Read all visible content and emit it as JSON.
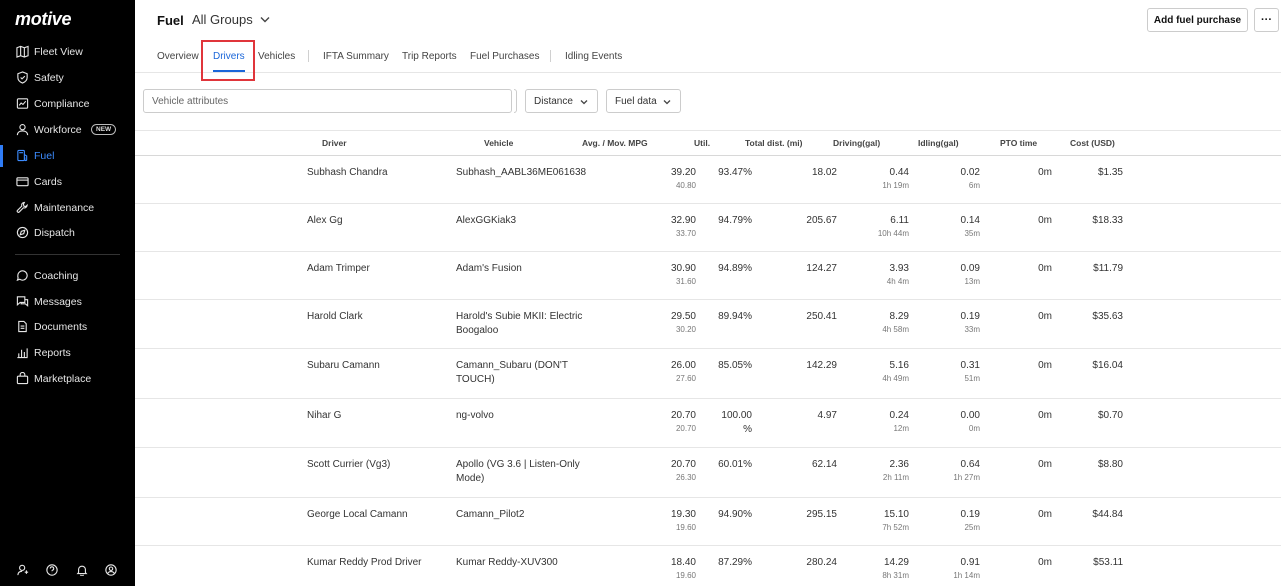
{
  "app": {
    "logo": "motive"
  },
  "sidebar": {
    "items": [
      {
        "label": "Fleet View",
        "icon": "map-icon"
      },
      {
        "label": "Safety",
        "icon": "shield-icon"
      },
      {
        "label": "Compliance",
        "icon": "compliance-icon"
      },
      {
        "label": "Workforce",
        "icon": "person-icon",
        "badge": "NEW"
      },
      {
        "label": "Fuel",
        "icon": "fuel-icon",
        "active": true
      },
      {
        "label": "Cards",
        "icon": "card-icon"
      },
      {
        "label": "Maintenance",
        "icon": "wrench-icon"
      },
      {
        "label": "Dispatch",
        "icon": "dispatch-icon"
      },
      {
        "label": "Coaching",
        "icon": "coaching-icon"
      },
      {
        "label": "Messages",
        "icon": "messages-icon"
      },
      {
        "label": "Documents",
        "icon": "document-icon"
      },
      {
        "label": "Reports",
        "icon": "reports-icon"
      },
      {
        "label": "Marketplace",
        "icon": "bag-icon"
      }
    ],
    "bottom_icons": [
      "user-icon",
      "help-icon",
      "bell-icon",
      "account-icon"
    ]
  },
  "header": {
    "title": "Fuel",
    "group": "All Groups",
    "add_button": "Add fuel purchase",
    "more_button": "···"
  },
  "tabs": [
    {
      "label": "Overview"
    },
    {
      "label": "Drivers",
      "active": true
    },
    {
      "label": "Vehicles"
    },
    {
      "label": "IFTA Summary"
    },
    {
      "label": "Trip Reports"
    },
    {
      "label": "Fuel Purchases"
    },
    {
      "label": "Idling Events"
    }
  ],
  "filters": {
    "search_placeholder": "Vehicle attributes",
    "distance": "Distance",
    "fuel_data": "Fuel data"
  },
  "table": {
    "columns": [
      "Driver",
      "Vehicle",
      "Avg. / Mov. MPG",
      "Util.",
      "Total dist. (mi)",
      "Driving(gal)",
      "Idling(gal)",
      "PTO time",
      "Cost (USD)"
    ],
    "rows": [
      {
        "driver": "Subhash Chandra",
        "vehicle": "Subhash_AABL36ME061638",
        "avg": "39.20",
        "mov": "40.80",
        "util": "93.47%",
        "dist": "18.02",
        "driving": "0.44",
        "driving_time": "1h 19m",
        "idling": "0.02",
        "idling_time": "6m",
        "pto": "0m",
        "cost": "$1.35"
      },
      {
        "driver": "Alex Gg",
        "vehicle": "AlexGGKiak3",
        "avg": "32.90",
        "mov": "33.70",
        "util": "94.79%",
        "dist": "205.67",
        "driving": "6.11",
        "driving_time": "10h 44m",
        "idling": "0.14",
        "idling_time": "35m",
        "pto": "0m",
        "cost": "$18.33"
      },
      {
        "driver": "Adam Trimper",
        "vehicle": "Adam's Fusion",
        "avg": "30.90",
        "mov": "31.60",
        "util": "94.89%",
        "dist": "124.27",
        "driving": "3.93",
        "driving_time": "4h 4m",
        "idling": "0.09",
        "idling_time": "13m",
        "pto": "0m",
        "cost": "$11.79"
      },
      {
        "driver": "Harold Clark",
        "vehicle": "Harold's Subie MKII: Electric Boogaloo",
        "avg": "29.50",
        "mov": "30.20",
        "util": "89.94%",
        "dist": "250.41",
        "driving": "8.29",
        "driving_time": "4h 58m",
        "idling": "0.19",
        "idling_time": "33m",
        "pto": "0m",
        "cost": "$35.63"
      },
      {
        "driver": "Subaru Camann",
        "vehicle": "Camann_Subaru (DON'T TOUCH)",
        "avg": "26.00",
        "mov": "27.60",
        "util": "85.05%",
        "dist": "142.29",
        "driving": "5.16",
        "driving_time": "4h 49m",
        "idling": "0.31",
        "idling_time": "51m",
        "pto": "0m",
        "cost": "$16.04"
      },
      {
        "driver": "Nihar G",
        "vehicle": "ng-volvo",
        "avg": "20.70",
        "mov": "20.70",
        "util": "100.00 %",
        "dist": "4.97",
        "driving": "0.24",
        "driving_time": "12m",
        "idling": "0.00",
        "idling_time": "0m",
        "pto": "0m",
        "cost": "$0.70"
      },
      {
        "driver": "Scott Currier (Vg3)",
        "vehicle": "Apollo (VG 3.6 | Listen-Only Mode)",
        "avg": "20.70",
        "mov": "26.30",
        "util": "60.01%",
        "dist": "62.14",
        "driving": "2.36",
        "driving_time": "2h 11m",
        "idling": "0.64",
        "idling_time": "1h 27m",
        "pto": "0m",
        "cost": "$8.80"
      },
      {
        "driver": "George Local Camann",
        "vehicle": "Camann_Pilot2",
        "avg": "19.30",
        "mov": "19.60",
        "util": "94.90%",
        "dist": "295.15",
        "driving": "15.10",
        "driving_time": "7h 52m",
        "idling": "0.19",
        "idling_time": "25m",
        "pto": "0m",
        "cost": "$44.84"
      },
      {
        "driver": "Kumar Reddy Prod Driver",
        "vehicle": "Kumar Reddy-XUV300",
        "avg": "18.40",
        "mov": "19.60",
        "util": "87.29%",
        "dist": "280.24",
        "driving": "14.29",
        "driving_time": "8h 31m",
        "idling": "0.91",
        "idling_time": "1h 14m",
        "pto": "0m",
        "cost": "$53.11"
      }
    ]
  }
}
